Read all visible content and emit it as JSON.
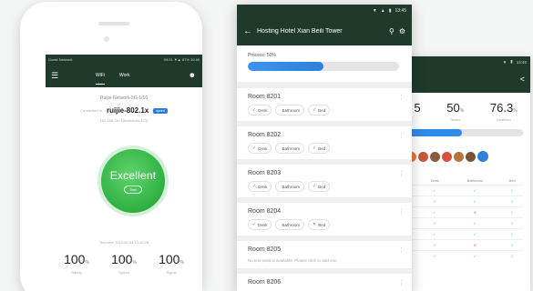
{
  "phone1": {
    "status_left": "Guest Network",
    "status_right": "09:21 ▼▲ 87% 10:45",
    "tabs": [
      "WiFi",
      "Work"
    ],
    "network_name": "Ruijie-Network-5G-1/10",
    "device_label": "Connected to",
    "device_name": "ruijie-802.1x",
    "badge": "speed",
    "host_info": "192.168.110.1(tested-for-123)",
    "status_word": "Excellent",
    "status_pill": "Test",
    "test_time": "Test time 2019-02-01 13:10:28",
    "stats": [
      {
        "value": "100",
        "unit": "%",
        "label": "Rating"
      },
      {
        "value": "100",
        "unit": "%",
        "label": "Speed"
      },
      {
        "value": "100",
        "unit": "%",
        "label": "Signal"
      }
    ]
  },
  "phone2": {
    "status_time": "13:45",
    "title": "Hosting Hotel Xian Beili Tower",
    "progress_label": "Process: 50%",
    "progress": 0.5,
    "rooms": [
      {
        "name": "Room 8201",
        "chips": [
          {
            "mark": "✓",
            "ok": true,
            "label": "Desk"
          },
          {
            "mark": "",
            "ok": true,
            "label": "Bathroom"
          },
          {
            "mark": "✓",
            "ok": true,
            "label": "Bed"
          }
        ]
      },
      {
        "name": "Room 8202",
        "chips": [
          {
            "mark": "✓",
            "ok": true,
            "label": "Desk"
          },
          {
            "mark": "",
            "ok": true,
            "label": "Bathroom"
          },
          {
            "mark": "✓",
            "ok": true,
            "label": "Bed"
          }
        ]
      },
      {
        "name": "Room 8203",
        "chips": [
          {
            "mark": "✓",
            "ok": true,
            "label": "Desk"
          },
          {
            "mark": "",
            "ok": true,
            "label": "Bathroom"
          },
          {
            "mark": "✓",
            "ok": true,
            "label": "Bed"
          }
        ]
      },
      {
        "name": "Room 8204",
        "chips": [
          {
            "mark": "✓",
            "ok": true,
            "label": "Desk"
          },
          {
            "mark": "",
            "ok": true,
            "label": "Bathroom"
          },
          {
            "mark": "✕",
            "ok": false,
            "label": "Bed"
          }
        ]
      },
      {
        "name": "Room 8205",
        "empty": "No test point is available. Please click to add one."
      },
      {
        "name": "Room 8206"
      }
    ]
  },
  "phone3": {
    "status_time": "13:45",
    "stats": [
      {
        "value": "5",
        "unit": "",
        "label": ""
      },
      {
        "value": "50",
        "unit": "%",
        "label": "Tested"
      },
      {
        "value": "76.3",
        "unit": "%",
        "label": "Qualified"
      }
    ],
    "progress": 0.5,
    "avatar_colors": [
      "#e8743b",
      "#c9573a",
      "#8a5a3c",
      "#d94f3d",
      "#b7743f",
      "#7a5238",
      "#2f7fd8"
    ],
    "table_headers": [
      "",
      "Desk",
      "Bathroom",
      "Bed"
    ],
    "table_rows": [
      [
        "✓",
        "✓",
        "✓"
      ],
      [
        "✓",
        "✓",
        "✓"
      ],
      [
        "✓",
        "✕",
        "✓"
      ],
      [
        "✓",
        "✓",
        "✓"
      ],
      [
        "✓",
        "✓",
        "✓"
      ],
      [
        "✓",
        "✕",
        "✓"
      ],
      [
        "✓",
        "✓",
        "✓"
      ]
    ]
  },
  "colors": {
    "toolbar": "#1f3a2a",
    "accent_blue": "#2d8ae6",
    "excellent_green": "#2fb042",
    "check_green": "#3c9a4e",
    "cross_red": "#e05a3a"
  }
}
